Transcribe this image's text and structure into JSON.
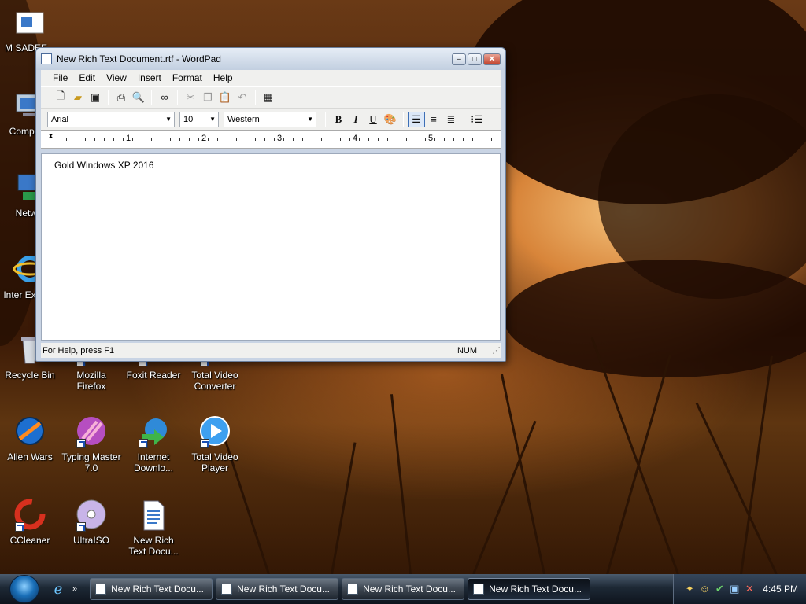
{
  "desktop": {
    "icons": [
      {
        "label": "M SADEE..."
      },
      {
        "label": "Computer"
      },
      {
        "label": "Netw..."
      },
      {
        "label": "Inter Explo..."
      },
      {
        "label": "Recycle Bin"
      },
      {
        "label": "Mozilla Firefox"
      },
      {
        "label": "Foxit Reader"
      },
      {
        "label": "Total Video Converter"
      },
      {
        "label": "Alien Wars"
      },
      {
        "label": "Typing Master 7.0"
      },
      {
        "label": "Internet Downlo..."
      },
      {
        "label": "Total Video Player"
      },
      {
        "label": "CCleaner"
      },
      {
        "label": "UltraISO"
      },
      {
        "label": "New Rich Text Docu..."
      }
    ]
  },
  "window": {
    "title": "New Rich Text Document.rtf - WordPad",
    "minimize_glyph": "–",
    "maximize_glyph": "□",
    "close_glyph": "✕",
    "menu": [
      "File",
      "Edit",
      "View",
      "Insert",
      "Format",
      "Help"
    ],
    "toolbar": {
      "new_icon": "new-document-icon",
      "open_icon": "open-folder-icon",
      "save_icon": "save-disk-icon",
      "print_icon": "printer-icon",
      "preview_icon": "print-preview-icon",
      "find_icon": "binoculars-icon",
      "cut_icon": "scissors-icon",
      "copy_icon": "copy-icon",
      "paste_icon": "paste-icon",
      "undo_icon": "undo-icon",
      "datetime_icon": "date-time-icon"
    },
    "format": {
      "font": "Arial",
      "size": "10",
      "script": "Western",
      "bold": "B",
      "italic": "I",
      "underline": "U",
      "alignment": "left"
    },
    "ruler": [
      "1",
      "2",
      "3",
      "4",
      "5"
    ],
    "document_text": "Gold Windows XP 2016",
    "status": {
      "help": "For Help, press F1",
      "num": "NUM"
    }
  },
  "taskbar": {
    "buttons": [
      {
        "label": "New Rich Text Docu...",
        "active": false
      },
      {
        "label": "New Rich Text Docu...",
        "active": false
      },
      {
        "label": "New Rich Text Docu...",
        "active": false
      },
      {
        "label": "New Rich Text Docu...",
        "active": true
      }
    ],
    "quicklaunch_more": "»",
    "clock": "4:45 PM"
  },
  "colors": {
    "title_accent": "#c2412b",
    "taskbar": "#1d2835"
  }
}
